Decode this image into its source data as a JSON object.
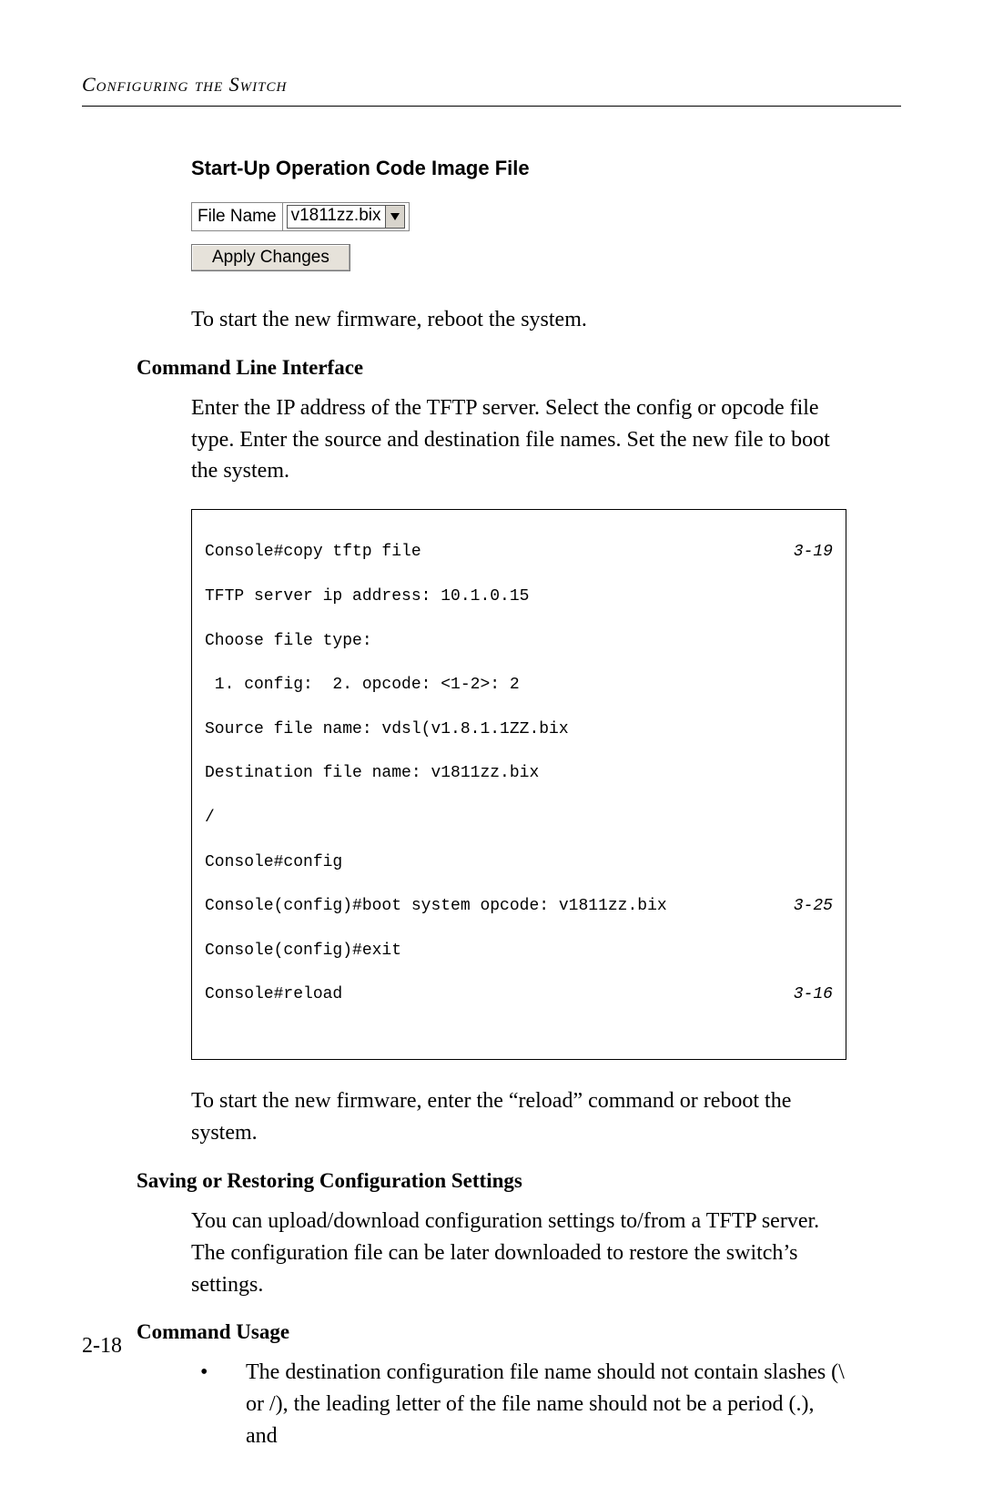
{
  "running_head": "Configuring the Switch",
  "ui": {
    "title": "Start-Up Operation Code Image File",
    "file_label": "File Name",
    "file_selected": "v1811zz.bix",
    "apply_label": "Apply Changes"
  },
  "p_after_ui": "To start the new firmware, reboot the system.",
  "cli_heading": "Command Line Interface",
  "cli_intro": "Enter the IP address of the TFTP server. Select the config or opcode file type. Enter the source and destination file names. Set the new file to boot the system.",
  "console": {
    "l1": "Console#copy tftp file",
    "r1": "3-19",
    "l2": "TFTP server ip address: 10.1.0.15",
    "l3": "Choose file type:",
    "l4": " 1. config:  2. opcode: <1-2>: 2",
    "l5": "Source file name: vdsl(v1.8.1.1ZZ.bix",
    "l6": "Destination file name: v1811zz.bix",
    "l7": "/",
    "l8": "Console#config",
    "l9": "Console(config)#boot system opcode: v1811zz.bix",
    "r9": "3-25",
    "l10": "Console(config)#exit",
    "l11": "Console#reload",
    "r11": "3-16"
  },
  "p_after_console": "To start the new firmware, enter the “reload” command or reboot the system.",
  "save_heading": "Saving or Restoring Configuration Settings",
  "save_body": "You can upload/download configuration settings to/from a TFTP server. The configuration file can be later downloaded to restore the switch’s settings.",
  "usage_heading": "Command Usage",
  "usage_bullet": "The destination configuration file name should not contain slashes (\\ or /), the leading letter of the file name should not be a period (.), and",
  "page_number": "2-18"
}
